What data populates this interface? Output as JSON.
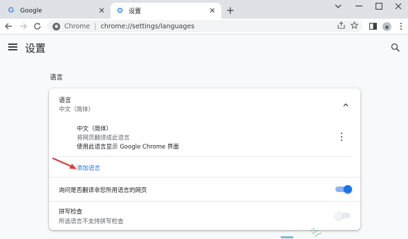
{
  "browser": {
    "tabs": [
      {
        "title": "Google",
        "favicon": "google-g-icon"
      },
      {
        "title": "设置",
        "favicon": "gear-icon",
        "active": true
      }
    ],
    "omnibox": {
      "scheme_label": "Chrome",
      "url": "chrome://settings/languages"
    }
  },
  "settings": {
    "page_title": "设置",
    "section_title": "语言",
    "languages_card": {
      "header_label": "语言",
      "header_value": "中文（简体）",
      "language_item": {
        "name": "中文（简体）",
        "line2": "将网页翻译成此语言",
        "line3": "使用此语言显示 Google Chrome 界面"
      },
      "add_language": "添加语言"
    },
    "offer_translate": {
      "label": "询问是否翻译非您所用语言的网页",
      "enabled": true
    },
    "spell_check": {
      "label": "拼写检查",
      "sub": "所选语言不支持拼写检查",
      "enabled": false
    }
  },
  "colors": {
    "accent": "#1a73e8",
    "annotation_arrow": "#e53935"
  }
}
